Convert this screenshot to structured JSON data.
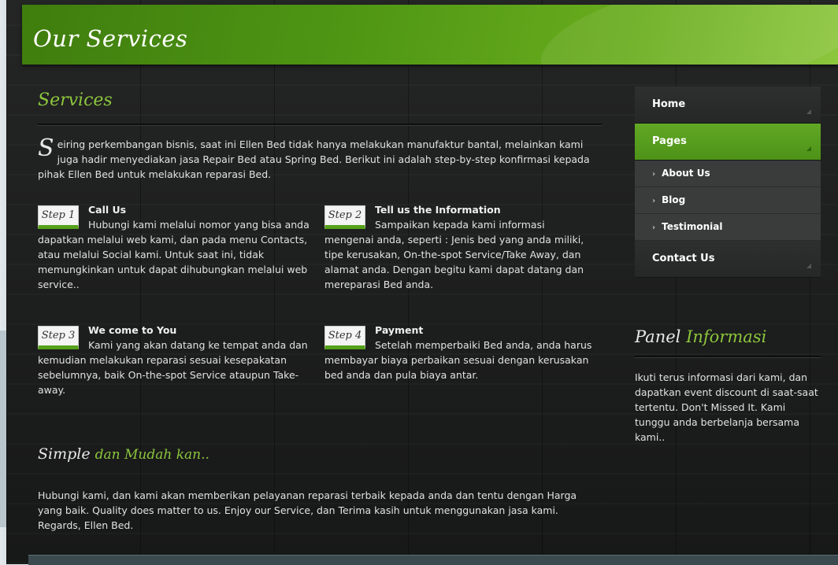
{
  "header": {
    "title": "Our Services"
  },
  "main": {
    "section_title": "Services",
    "intro_dropcap": "S",
    "intro_text": "eiring perkembangan bisnis, saat ini Ellen Bed tidak hanya melakukan manufaktur bantal, melainkan kami juga hadir menyediakan jasa Repair Bed atau Spring Bed. Berikut ini adalah step-by-step konfirmasi kepada pihak Ellen Bed untuk melakukan reparasi Bed.",
    "steps": [
      {
        "badge": "Step 1",
        "title": "Call Us",
        "text": "Hubungi kami melalui nomor yang bisa anda dapatkan melalui web kami, dan pada menu Contacts, atau melalui Social kami. Untuk saat ini, tidak memungkinkan untuk dapat dihubungkan melalui web service.."
      },
      {
        "badge": "Step 2",
        "title": "Tell us the Information",
        "text": "Sampaikan kepada kami informasi mengenai anda, seperti : Jenis bed yang anda miliki, tipe kerusakan, On-the-spot Service/Take Away, dan alamat anda. Dengan begitu kami dapat datang dan mereparasi Bed anda."
      },
      {
        "badge": "Step 3",
        "title": "We come to You",
        "text": "Kami yang akan datang ke tempat anda dan kemudian melakukan reparasi sesuai kesepakatan sebelumnya, baik On-the-spot Service ataupun Take-away."
      },
      {
        "badge": "Step 4",
        "title": "Payment",
        "text": "Setelah memperbaiki Bed anda, anda harus membayar biaya perbaikan sesuai dengan kerusakan bed anda dan pula biaya antar."
      }
    ],
    "simple_title_white": "Simple",
    "simple_title_green": "dan Mudah kan..",
    "simple_text": "Hubungi kami, dan kami akan memberikan pelayanan reparasi terbaik kepada anda dan tentu dengan Harga yang baik. Quality does matter to us. Enjoy our Service, dan Terima kasih untuk menggunakan jasa kami. Regards, Ellen Bed."
  },
  "sidebar": {
    "nav": [
      {
        "label": "Home"
      },
      {
        "label": "Pages"
      },
      {
        "label": "Contact Us"
      }
    ],
    "subnav": [
      {
        "label": "About Us"
      },
      {
        "label": "Blog"
      },
      {
        "label": "Testimonial"
      }
    ],
    "panel_title_white": "Panel",
    "panel_title_green": "Informasi",
    "panel_text": "Ikuti terus informasi dari kami, dan dapatkan event discount di saat-saat tertentu. Don't Missed It. Kami tunggu anda berbelanja bersama kami.."
  },
  "colors": {
    "accent_green": "#8cc63d",
    "header_green": "#4f9614",
    "nav_active": "#5aa020",
    "background": "#1c1d1d"
  },
  "icons": {
    "submenu_arrow": "chevron-right-icon",
    "nav_corner": "corner-triangle-icon"
  }
}
